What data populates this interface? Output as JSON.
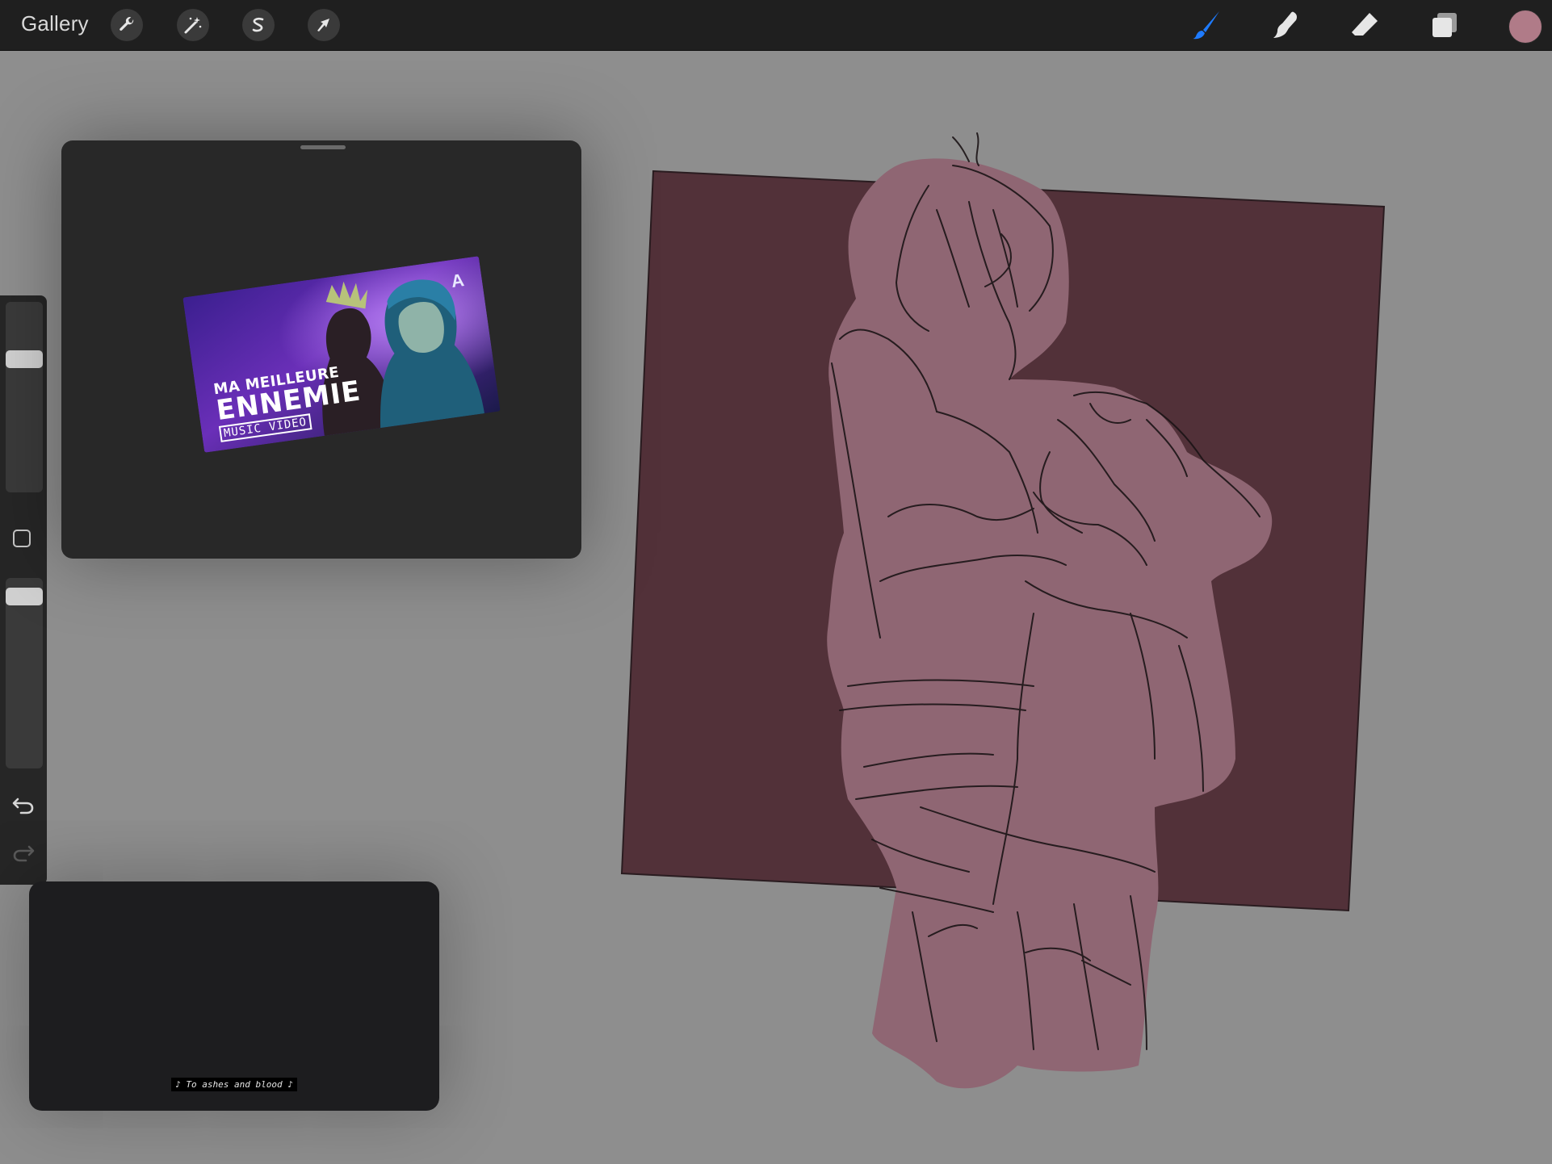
{
  "toolbar": {
    "gallery_label": "Gallery",
    "left_tools": [
      "wrench-icon",
      "magic-wand-icon",
      "selection-icon",
      "move-arrow-icon"
    ],
    "right_tools": [
      "brush-icon",
      "smudge-icon",
      "eraser-icon",
      "layers-icon"
    ],
    "active_tool": "brush-icon",
    "current_color": "#b07b88",
    "accent_color": "#1e7bff"
  },
  "sidebar": {
    "brush_size_level": 0.28,
    "opacity_level": 0.07,
    "undo_icon": "undo-icon",
    "redo_icon": "redo-icon"
  },
  "video_window": {
    "thumbnail_line1": "MA MEILLEURE",
    "thumbnail_line2": "ENNEMIE",
    "thumbnail_line3": "MUSIC VIDEO",
    "badge": "A"
  },
  "lyrics_window": {
    "caption": "♪ To ashes and blood ♪"
  },
  "canvas": {
    "background_color": "#8e8e8e",
    "frame_color": "#523139",
    "figure_fill_color": "#8f6673"
  }
}
